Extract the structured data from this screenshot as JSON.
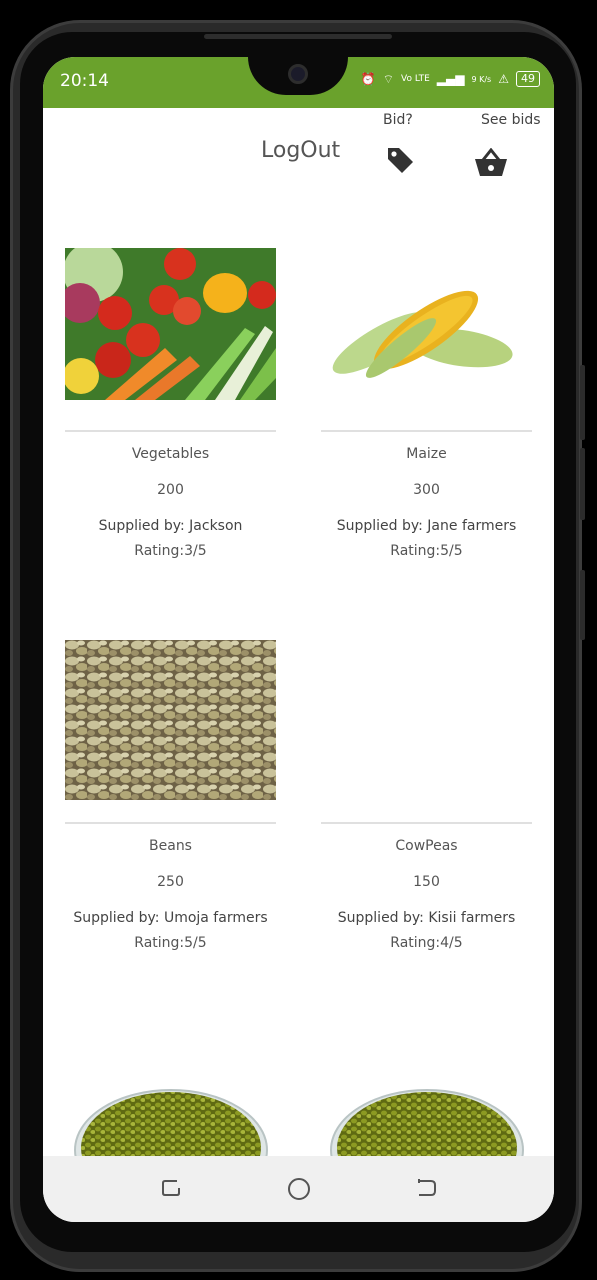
{
  "status": {
    "time": "20:14",
    "network": "Vo LTE",
    "speed": "9 K/s",
    "battery": "49"
  },
  "header": {
    "logout": "LogOut",
    "bid_label": "Bid?",
    "see_bids_label": "See bids"
  },
  "products": [
    {
      "name": "Vegetables",
      "price": "200",
      "supplier": "Supplied by: Jackson",
      "rating": "Rating:3/5"
    },
    {
      "name": "Maize",
      "price": "300",
      "supplier": "Supplied by: Jane farmers",
      "rating": "Rating:5/5"
    },
    {
      "name": "Beans",
      "price": "250",
      "supplier": "Supplied by: Umoja farmers",
      "rating": "Rating:5/5"
    },
    {
      "name": "CowPeas",
      "price": "150",
      "supplier": "Supplied by: Kisii farmers",
      "rating": "Rating:4/5"
    }
  ],
  "colors": {
    "status_bar": "#6aa22c"
  }
}
